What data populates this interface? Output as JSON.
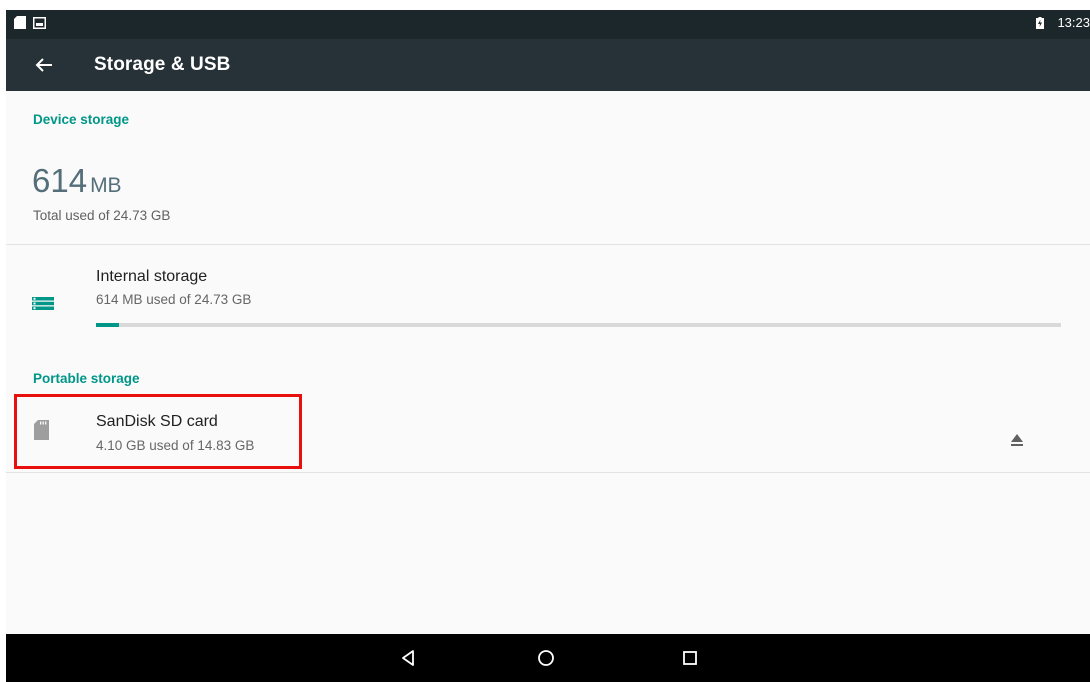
{
  "status_bar": {
    "time": "13:23",
    "icons": [
      "sd-card-notification-icon",
      "image-notification-icon",
      "battery-charging-icon"
    ]
  },
  "app_bar": {
    "title": "Storage & USB",
    "back_icon": "arrow-back-icon"
  },
  "device_storage": {
    "header": "Device storage",
    "total_used_value": "614",
    "total_used_unit": "MB",
    "total_used_summary": "Total used of 24.73 GB",
    "volumes": [
      {
        "title": "Internal storage",
        "summary": "614 MB used of 24.73 GB",
        "icon": "storage-icon",
        "used_fraction": 0.024
      }
    ]
  },
  "portable_storage": {
    "header": "Portable storage",
    "volumes": [
      {
        "title": "SanDisk SD card",
        "summary": "4.10 GB used of 14.83 GB",
        "icon": "sd-card-icon",
        "action_icon": "eject-icon"
      }
    ]
  },
  "nav_bar": {
    "buttons": [
      "back-triangle-icon",
      "home-circle-icon",
      "recents-square-icon"
    ]
  },
  "colors": {
    "accent": "#009688",
    "app_bar": "#263238",
    "status_bar": "#1c272c",
    "highlight": "#e8100c"
  }
}
